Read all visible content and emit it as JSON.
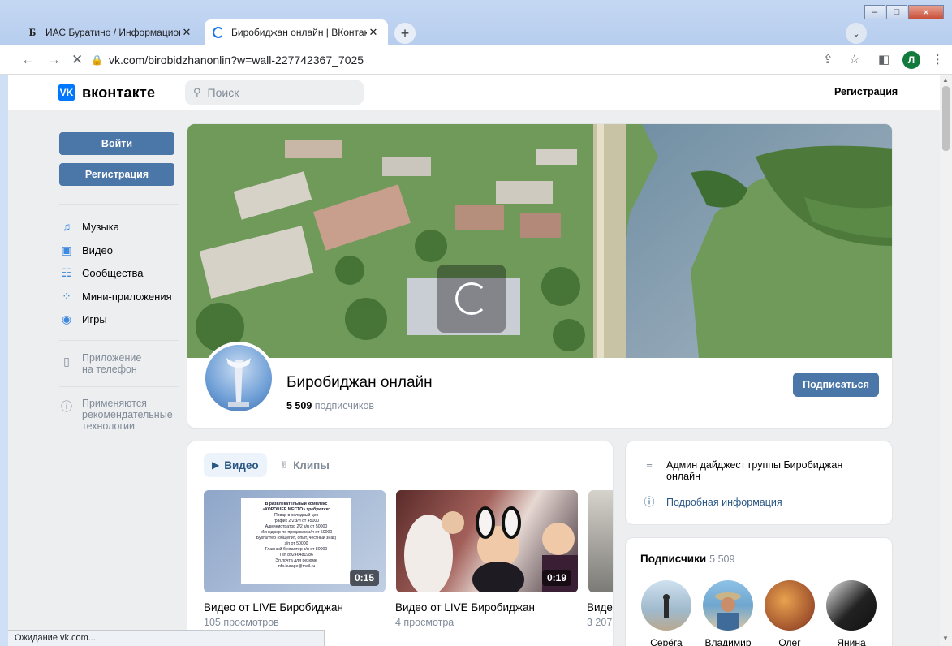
{
  "browser": {
    "tabs": [
      {
        "favicon": "Б",
        "title": "ИАС Буратино / Информационн",
        "active": false
      },
      {
        "title": "Биробиджан онлайн | ВКонтакте",
        "active": true
      }
    ],
    "url": "vk.com/birobidzhanonlin?w=wall-227742367_7025",
    "profile_initial": "Л",
    "status": "Ожидание vk.com..."
  },
  "header": {
    "logo_mark": "VK",
    "logo_text": "вконтакте",
    "search_placeholder": "Поиск",
    "register": "Регистрация"
  },
  "left_menu": {
    "login_button": "Войти",
    "register_button": "Регистрация",
    "items": [
      {
        "icon": "music-icon",
        "label": "Музыка"
      },
      {
        "icon": "video-icon",
        "label": "Видео"
      },
      {
        "icon": "communities-icon",
        "label": "Сообщества"
      },
      {
        "icon": "mini-apps-icon",
        "label": "Мини-приложения"
      },
      {
        "icon": "games-icon",
        "label": "Игры"
      }
    ],
    "app_note": [
      "Приложение",
      "на телефон"
    ],
    "tech_note": [
      "Применяются",
      "рекомендательные",
      "технологии"
    ]
  },
  "group": {
    "name": "Биробиджан онлайн",
    "subscribers_count": "5 509",
    "subscribers_word": "подписчиков",
    "subscribe_button": "Подписаться"
  },
  "videos": {
    "tabs": {
      "video": "Видео",
      "clips": "Клипы"
    },
    "items": [
      {
        "title": "Видео от LIVE Биробиджан",
        "views": "105 просмотров",
        "duration": "0:15"
      },
      {
        "title": "Видео от LIVE Биробиджан",
        "views": "4 просмотра",
        "duration": "0:19"
      },
      {
        "title": "Виде",
        "views": "3 207"
      }
    ],
    "poster_lines": [
      "В развлекательный комплекс",
      "«ХОРОШЕЕ МЕСТО» требуются:",
      "Повар в холодный цех",
      "график 2/2 з/п от 45000",
      "Администратор 2/2 з/п от 50000",
      "Менеджер по продажам з/п от 50000",
      "Бухгалтер (общепит, опыт, честный знак)",
      "з/п от 50000",
      "Главный бухгалтер з/п от 80000",
      "Тел 89246481986",
      "Эл.почта для резюме",
      "info.kurage@mail.ru"
    ]
  },
  "info": {
    "digest": [
      "Админ дайджест группы Биробиджан",
      "онлайн"
    ],
    "more": "Подробная информация"
  },
  "subscribers": {
    "title": "Подписчики",
    "count": "5 509",
    "members": [
      "Серёга",
      "Владимир",
      "Олег",
      "Янина"
    ]
  },
  "colors": {
    "accent": "#4a76a8",
    "brand": "#0077ff",
    "link": "#2a5885"
  }
}
